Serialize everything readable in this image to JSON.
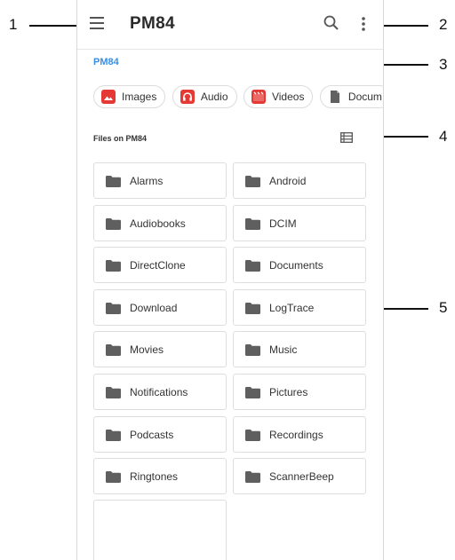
{
  "appbar": {
    "title": "PM84"
  },
  "breadcrumb": "PM84",
  "chips": [
    {
      "label": "Images",
      "icon": "image-icon",
      "color": "#e53935"
    },
    {
      "label": "Audio",
      "icon": "headphones-icon",
      "color": "#e53935"
    },
    {
      "label": "Videos",
      "icon": "video-icon",
      "color": "#e53935"
    },
    {
      "label": "Docum",
      "icon": "document-icon",
      "color": "#616161"
    }
  ],
  "section_label": "Files on PM84",
  "folders": [
    "Alarms",
    "Android",
    "Audiobooks",
    "DCIM",
    "DirectClone",
    "Documents",
    "Download",
    "LogTrace",
    "Movies",
    "Music",
    "Notifications",
    "Pictures",
    "Podcasts",
    "Recordings",
    "Ringtones",
    "ScannerBeep"
  ],
  "callouts": [
    "1",
    "2",
    "3",
    "4",
    "5"
  ],
  "colors": {
    "accent": "#3a8ee0",
    "folder": "#5f5f5f",
    "chip_red": "#e53935"
  }
}
